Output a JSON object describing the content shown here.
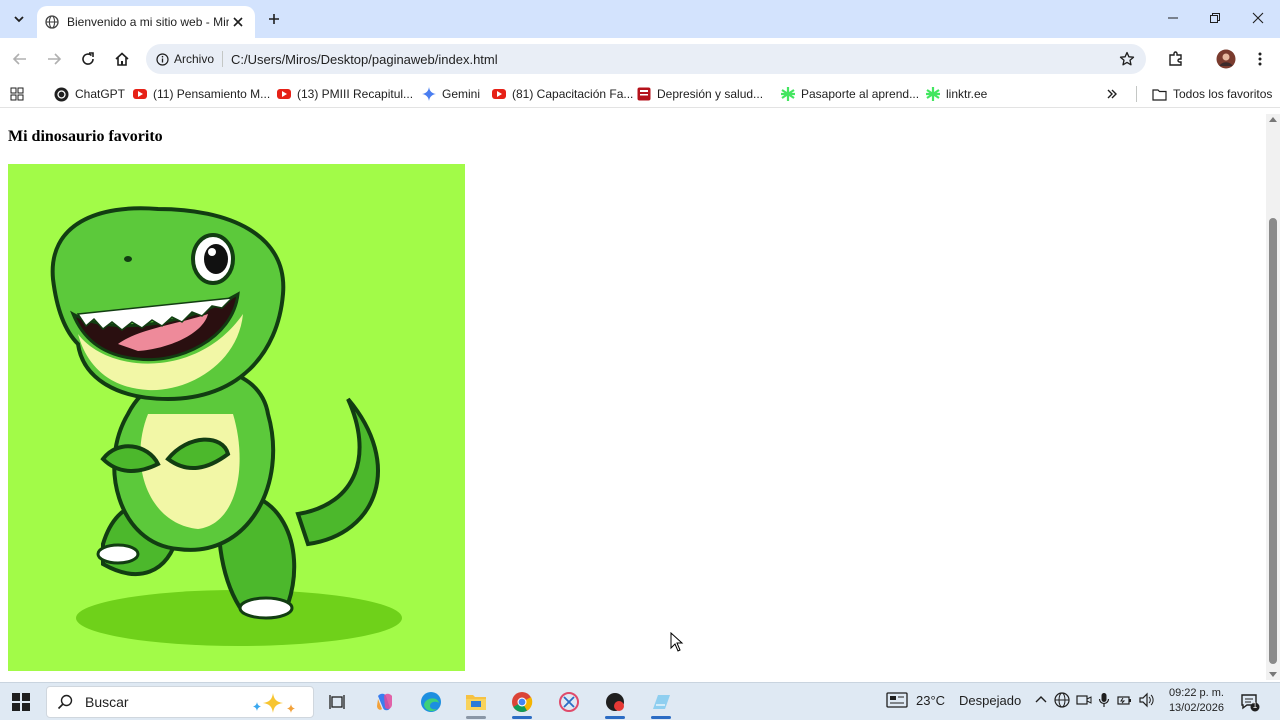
{
  "browser": {
    "tab": {
      "title": "Bienvenido a mi sitio web - Mir"
    },
    "address": {
      "chip_label": "Archivo",
      "url": "C:/Users/Miros/Desktop/paginaweb/index.html"
    },
    "bookmarks": [
      {
        "label": "ChatGPT",
        "icon": "chatgpt-icon"
      },
      {
        "label": "(11) Pensamiento M...",
        "icon": "youtube-icon"
      },
      {
        "label": "(13) PMIII Recapitul...",
        "icon": "youtube-icon"
      },
      {
        "label": "Gemini",
        "icon": "gemini-icon"
      },
      {
        "label": "(81) Capacitación Fa...",
        "icon": "youtube-icon"
      },
      {
        "label": "Depresión y salud...",
        "icon": "site-icon"
      },
      {
        "label": "Pasaporte al aprend...",
        "icon": "linktree-icon"
      },
      {
        "label": "linktr.ee",
        "icon": "linktree-icon"
      }
    ],
    "all_bookmarks_label": "Todos los favoritos"
  },
  "page": {
    "heading": "Mi dinosaurio favorito",
    "image_bg": "#a2fb48"
  },
  "taskbar": {
    "search_placeholder": "Buscar",
    "weather": {
      "temp": "23°C",
      "condition": "Despejado"
    },
    "clock": {
      "time": "09:22 p. m.",
      "date": "13/02/2026"
    },
    "notification_count": "1"
  },
  "colors": {
    "tabstrip": "#d3e3fd",
    "omnibox": "#e9eef6",
    "taskbar": "#dfe9f3",
    "dino_green": "#5cc93b"
  }
}
